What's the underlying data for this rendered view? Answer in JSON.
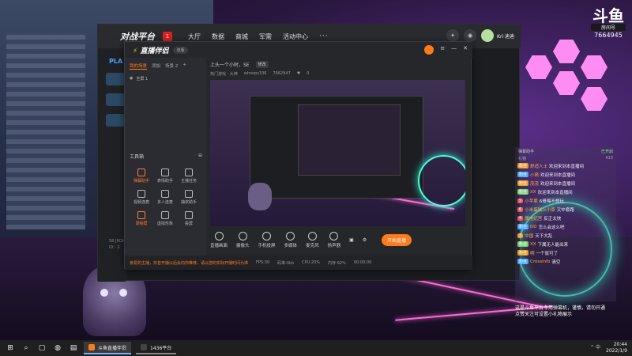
{
  "overlay": {
    "logo": "斗鱼",
    "sub": "房间号",
    "room_number": "7664945"
  },
  "main_window": {
    "logo": "对战平台",
    "badge": "1",
    "nav": [
      "大厅",
      "数据",
      "商城",
      "军需",
      "活动中心",
      "···"
    ],
    "user": "Kri·迪迪",
    "left_label": "PLA",
    "left_footer": [
      "58 [KOH",
      "ID：2"
    ]
  },
  "obs_window": {
    "logo": "直播伴侣",
    "pill": "旧版",
    "tabs": [
      "我的场景",
      "添加",
      "场景 2",
      "+"
    ],
    "scene_item": "全屏 1",
    "tools_title": "工具箱",
    "tools": [
      {
        "label": "弹幕助手",
        "hot": true
      },
      {
        "label": "表情助手",
        "hot": false
      },
      {
        "label": "主播任务",
        "hot": false
      },
      {
        "label": "视频连麦",
        "hot": false
      },
      {
        "label": "多人连麦",
        "hot": false
      },
      {
        "label": "抽奖助手",
        "hot": false
      },
      {
        "label": "录制屏",
        "hot": true
      },
      {
        "label": "虚拟形象",
        "hot": false
      },
      {
        "label": "投屏",
        "hot": false
      }
    ],
    "header": {
      "title": "上头一个小时，SE",
      "tag": "修改",
      "category": "热门游戏 · 大神",
      "owner": "whoops336",
      "room": "7662947",
      "likes": "0"
    },
    "bottom_bar": [
      "直播画面",
      "摄像头",
      "手机投屏",
      "多媒体",
      "麦克风",
      "扬声器"
    ],
    "start_button": "开始直播",
    "status": {
      "notice": "亲爱的主播，抖音开播以后会向你推荐，请以您的实际开播时间为准",
      "fps": "FPS:30",
      "bitrate": "码率:0kb",
      "cpu": "CPU:20%",
      "mem": "内存:92%",
      "time": "00:00:00"
    }
  },
  "chat": {
    "head_left": "弹幕助手",
    "head_right": "已开启",
    "sub_left": "礼物",
    "sub_right": "415",
    "messages": [
      {
        "badge": "粉丝",
        "color": "#e3a02a",
        "name": "舒适人士",
        "msg": "欢迎来到本直播间"
      },
      {
        "badge": "粉丝",
        "color": "#4aa8ff",
        "name": "小萌",
        "msg": "欢迎来到本直播间"
      },
      {
        "badge": "粉丝",
        "color": "#e3a02a",
        "name": "茂茂",
        "msg": "欢迎来到本直播间"
      },
      {
        "badge": "粉丝",
        "color": "#7ad36b",
        "name": "XX",
        "msg": "欢迎来到本直播间"
      },
      {
        "badge": "5",
        "color": "#e35a5a",
        "name": "小苹果",
        "msg": "6哥嗨不想玩"
      },
      {
        "badge": "6",
        "color": "#e35a5a",
        "name": "小米蛋糕上小菜",
        "msg": "又中套路"
      },
      {
        "badge": "4",
        "color": "#e35a5a",
        "name": "魔电妃宫",
        "msg": "反正太快"
      },
      {
        "badge": "粉丝",
        "color": "#4aa8ff",
        "name": "DD",
        "msg": "怎么会这么吧"
      },
      {
        "badge": "3",
        "color": "#e3a02a",
        "name": "中国",
        "msg": "天下大乱"
      },
      {
        "badge": "粉丝",
        "color": "#7ad36b",
        "name": "XX",
        "msg": "下属无人能出来"
      },
      {
        "badge": "粉丝",
        "color": "#e3a02a",
        "name": "明",
        "msg": "一个就可了"
      },
      {
        "badge": "粉丝",
        "color": "#4aa8ff",
        "name": "Crossinfo",
        "msg": "清空"
      }
    ],
    "footer": [
      "这是斗鱼平台专用弹幕机，谨慎，请勿开通",
      "点赞关注可设置小礼物展示"
    ]
  },
  "taskbar": {
    "tasks": [
      "斗鱼直播伴侣",
      "1436平台"
    ],
    "tray": "^ 中",
    "time": "20:44",
    "date": "2022/1/9"
  }
}
